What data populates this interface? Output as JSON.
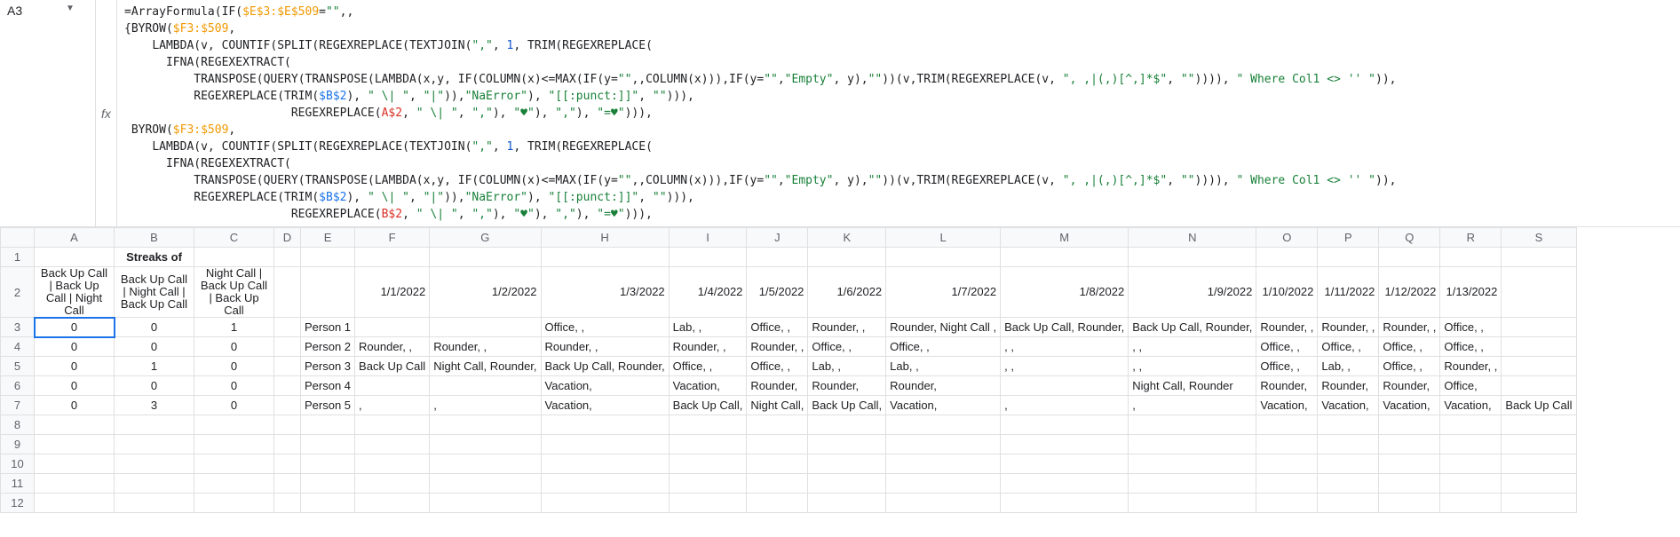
{
  "name_box": "A3",
  "formula_tokens": [
    [
      {
        "t": "=",
        "c": "tok-eq"
      },
      {
        "t": "ArrayFormula",
        "c": "tok-fn"
      },
      {
        "t": "(",
        "c": "tok-punct"
      },
      {
        "t": "IF",
        "c": "tok-fn"
      },
      {
        "t": "(",
        "c": "tok-punct"
      },
      {
        "t": "$E$3:$E$509",
        "c": "tok-ref1"
      },
      {
        "t": "=",
        "c": "tok-punct"
      },
      {
        "t": "\"\"",
        "c": "tok-str"
      },
      {
        "t": ",,",
        "c": "tok-punct"
      }
    ],
    [
      {
        "t": "{",
        "c": "tok-punct"
      },
      {
        "t": "BYROW",
        "c": "tok-fn"
      },
      {
        "t": "(",
        "c": "tok-punct"
      },
      {
        "t": "$F3:$509",
        "c": "tok-ref1"
      },
      {
        "t": ",",
        "c": "tok-punct"
      }
    ],
    [
      {
        "t": "    ",
        "c": ""
      },
      {
        "t": "LAMBDA",
        "c": "tok-fn"
      },
      {
        "t": "(v, ",
        "c": "tok-punct"
      },
      {
        "t": "COUNTIF",
        "c": "tok-fn"
      },
      {
        "t": "(",
        "c": "tok-punct"
      },
      {
        "t": "SPLIT",
        "c": "tok-fn"
      },
      {
        "t": "(",
        "c": "tok-punct"
      },
      {
        "t": "REGEXREPLACE",
        "c": "tok-fn"
      },
      {
        "t": "(",
        "c": "tok-punct"
      },
      {
        "t": "TEXTJOIN",
        "c": "tok-fn"
      },
      {
        "t": "(",
        "c": "tok-punct"
      },
      {
        "t": "\",\"",
        "c": "tok-str"
      },
      {
        "t": ", ",
        "c": "tok-punct"
      },
      {
        "t": "1",
        "c": "tok-num"
      },
      {
        "t": ", ",
        "c": "tok-punct"
      },
      {
        "t": "TRIM",
        "c": "tok-fn"
      },
      {
        "t": "(",
        "c": "tok-punct"
      },
      {
        "t": "REGEXREPLACE",
        "c": "tok-fn"
      },
      {
        "t": "(",
        "c": "tok-punct"
      }
    ],
    [
      {
        "t": "      ",
        "c": ""
      },
      {
        "t": "IFNA",
        "c": "tok-fn"
      },
      {
        "t": "(",
        "c": "tok-punct"
      },
      {
        "t": "REGEXEXTRACT",
        "c": "tok-fn"
      },
      {
        "t": "(",
        "c": "tok-punct"
      }
    ],
    [
      {
        "t": "          ",
        "c": ""
      },
      {
        "t": "TRANSPOSE",
        "c": "tok-fn"
      },
      {
        "t": "(",
        "c": "tok-punct"
      },
      {
        "t": "QUERY",
        "c": "tok-fn"
      },
      {
        "t": "(",
        "c": "tok-punct"
      },
      {
        "t": "TRANSPOSE",
        "c": "tok-fn"
      },
      {
        "t": "(",
        "c": "tok-punct"
      },
      {
        "t": "LAMBDA",
        "c": "tok-fn"
      },
      {
        "t": "(x,y, ",
        "c": "tok-punct"
      },
      {
        "t": "IF",
        "c": "tok-fn"
      },
      {
        "t": "(",
        "c": "tok-punct"
      },
      {
        "t": "COLUMN",
        "c": "tok-fn"
      },
      {
        "t": "(x)<=",
        "c": "tok-punct"
      },
      {
        "t": "MAX",
        "c": "tok-fn"
      },
      {
        "t": "(",
        "c": "tok-punct"
      },
      {
        "t": "IF",
        "c": "tok-fn"
      },
      {
        "t": "(y=",
        "c": "tok-punct"
      },
      {
        "t": "\"\"",
        "c": "tok-str"
      },
      {
        "t": ",,",
        "c": "tok-punct"
      },
      {
        "t": "COLUMN",
        "c": "tok-fn"
      },
      {
        "t": "(x))),",
        "c": "tok-punct"
      },
      {
        "t": "IF",
        "c": "tok-fn"
      },
      {
        "t": "(y=",
        "c": "tok-punct"
      },
      {
        "t": "\"\"",
        "c": "tok-str"
      },
      {
        "t": ",",
        "c": "tok-punct"
      },
      {
        "t": "\"Empty\"",
        "c": "tok-str"
      },
      {
        "t": ", y),",
        "c": "tok-punct"
      },
      {
        "t": "\"\"",
        "c": "tok-str"
      },
      {
        "t": "))(v,",
        "c": "tok-punct"
      },
      {
        "t": "TRIM",
        "c": "tok-fn"
      },
      {
        "t": "(",
        "c": "tok-punct"
      },
      {
        "t": "REGEXREPLACE",
        "c": "tok-fn"
      },
      {
        "t": "(v, ",
        "c": "tok-punct"
      },
      {
        "t": "\", ,|(,)[^,]*$\"",
        "c": "tok-str"
      },
      {
        "t": ", ",
        "c": "tok-punct"
      },
      {
        "t": "\"\"",
        "c": "tok-str"
      },
      {
        "t": ")))), ",
        "c": "tok-punct"
      },
      {
        "t": "\" Where Col1 <> '' \"",
        "c": "tok-str"
      },
      {
        "t": ")),",
        "c": "tok-punct"
      }
    ],
    [
      {
        "t": "          ",
        "c": ""
      },
      {
        "t": "REGEXREPLACE",
        "c": "tok-fn"
      },
      {
        "t": "(",
        "c": "tok-punct"
      },
      {
        "t": "TRIM",
        "c": "tok-fn"
      },
      {
        "t": "(",
        "c": "tok-punct"
      },
      {
        "t": "$B$2",
        "c": "tok-ref2"
      },
      {
        "t": "), ",
        "c": "tok-punct"
      },
      {
        "t": "\" \\| \"",
        "c": "tok-str"
      },
      {
        "t": ", ",
        "c": "tok-punct"
      },
      {
        "t": "\"|\"",
        "c": "tok-str"
      },
      {
        "t": ")),",
        "c": "tok-punct"
      },
      {
        "t": "\"NaError\"",
        "c": "tok-str"
      },
      {
        "t": "), ",
        "c": "tok-punct"
      },
      {
        "t": "\"[[:punct:]]\"",
        "c": "tok-str"
      },
      {
        "t": ", ",
        "c": "tok-punct"
      },
      {
        "t": "\"\"",
        "c": "tok-str"
      },
      {
        "t": "))),",
        "c": "tok-punct"
      }
    ],
    [
      {
        "t": "                        ",
        "c": ""
      },
      {
        "t": "REGEXREPLACE",
        "c": "tok-fn"
      },
      {
        "t": "(",
        "c": "tok-punct"
      },
      {
        "t": "A$2",
        "c": "tok-ref3"
      },
      {
        "t": ", ",
        "c": "tok-punct"
      },
      {
        "t": "\" \\| \"",
        "c": "tok-str"
      },
      {
        "t": ", ",
        "c": "tok-punct"
      },
      {
        "t": "\",\"",
        "c": "tok-str"
      },
      {
        "t": "), ",
        "c": "tok-punct"
      },
      {
        "t": "\"♥\"",
        "c": "tok-str"
      },
      {
        "t": "), ",
        "c": "tok-punct"
      },
      {
        "t": "\",\"",
        "c": "tok-str"
      },
      {
        "t": "), ",
        "c": "tok-punct"
      },
      {
        "t": "\"=♥\"",
        "c": "tok-str"
      },
      {
        "t": "))),",
        "c": "tok-punct"
      }
    ],
    [
      {
        "t": " ",
        "c": ""
      },
      {
        "t": "BYROW",
        "c": "tok-fn"
      },
      {
        "t": "(",
        "c": "tok-punct"
      },
      {
        "t": "$F3:$509",
        "c": "tok-ref1"
      },
      {
        "t": ",",
        "c": "tok-punct"
      }
    ],
    [
      {
        "t": "    ",
        "c": ""
      },
      {
        "t": "LAMBDA",
        "c": "tok-fn"
      },
      {
        "t": "(v, ",
        "c": "tok-punct"
      },
      {
        "t": "COUNTIF",
        "c": "tok-fn"
      },
      {
        "t": "(",
        "c": "tok-punct"
      },
      {
        "t": "SPLIT",
        "c": "tok-fn"
      },
      {
        "t": "(",
        "c": "tok-punct"
      },
      {
        "t": "REGEXREPLACE",
        "c": "tok-fn"
      },
      {
        "t": "(",
        "c": "tok-punct"
      },
      {
        "t": "TEXTJOIN",
        "c": "tok-fn"
      },
      {
        "t": "(",
        "c": "tok-punct"
      },
      {
        "t": "\",\"",
        "c": "tok-str"
      },
      {
        "t": ", ",
        "c": "tok-punct"
      },
      {
        "t": "1",
        "c": "tok-num"
      },
      {
        "t": ", ",
        "c": "tok-punct"
      },
      {
        "t": "TRIM",
        "c": "tok-fn"
      },
      {
        "t": "(",
        "c": "tok-punct"
      },
      {
        "t": "REGEXREPLACE",
        "c": "tok-fn"
      },
      {
        "t": "(",
        "c": "tok-punct"
      }
    ],
    [
      {
        "t": "      ",
        "c": ""
      },
      {
        "t": "IFNA",
        "c": "tok-fn"
      },
      {
        "t": "(",
        "c": "tok-punct"
      },
      {
        "t": "REGEXEXTRACT",
        "c": "tok-fn"
      },
      {
        "t": "(",
        "c": "tok-punct"
      }
    ],
    [
      {
        "t": "          ",
        "c": ""
      },
      {
        "t": "TRANSPOSE",
        "c": "tok-fn"
      },
      {
        "t": "(",
        "c": "tok-punct"
      },
      {
        "t": "QUERY",
        "c": "tok-fn"
      },
      {
        "t": "(",
        "c": "tok-punct"
      },
      {
        "t": "TRANSPOSE",
        "c": "tok-fn"
      },
      {
        "t": "(",
        "c": "tok-punct"
      },
      {
        "t": "LAMBDA",
        "c": "tok-fn"
      },
      {
        "t": "(x,y, ",
        "c": "tok-punct"
      },
      {
        "t": "IF",
        "c": "tok-fn"
      },
      {
        "t": "(",
        "c": "tok-punct"
      },
      {
        "t": "COLUMN",
        "c": "tok-fn"
      },
      {
        "t": "(x)<=",
        "c": "tok-punct"
      },
      {
        "t": "MAX",
        "c": "tok-fn"
      },
      {
        "t": "(",
        "c": "tok-punct"
      },
      {
        "t": "IF",
        "c": "tok-fn"
      },
      {
        "t": "(y=",
        "c": "tok-punct"
      },
      {
        "t": "\"\"",
        "c": "tok-str"
      },
      {
        "t": ",,",
        "c": "tok-punct"
      },
      {
        "t": "COLUMN",
        "c": "tok-fn"
      },
      {
        "t": "(x))),",
        "c": "tok-punct"
      },
      {
        "t": "IF",
        "c": "tok-fn"
      },
      {
        "t": "(y=",
        "c": "tok-punct"
      },
      {
        "t": "\"\"",
        "c": "tok-str"
      },
      {
        "t": ",",
        "c": "tok-punct"
      },
      {
        "t": "\"Empty\"",
        "c": "tok-str"
      },
      {
        "t": ", y),",
        "c": "tok-punct"
      },
      {
        "t": "\"\"",
        "c": "tok-str"
      },
      {
        "t": "))(v,",
        "c": "tok-punct"
      },
      {
        "t": "TRIM",
        "c": "tok-fn"
      },
      {
        "t": "(",
        "c": "tok-punct"
      },
      {
        "t": "REGEXREPLACE",
        "c": "tok-fn"
      },
      {
        "t": "(v, ",
        "c": "tok-punct"
      },
      {
        "t": "\", ,|(,)[^,]*$\"",
        "c": "tok-str"
      },
      {
        "t": ", ",
        "c": "tok-punct"
      },
      {
        "t": "\"\"",
        "c": "tok-str"
      },
      {
        "t": ")))), ",
        "c": "tok-punct"
      },
      {
        "t": "\" Where Col1 <> '' \"",
        "c": "tok-str"
      },
      {
        "t": ")),",
        "c": "tok-punct"
      }
    ],
    [
      {
        "t": "          ",
        "c": ""
      },
      {
        "t": "REGEXREPLACE",
        "c": "tok-fn"
      },
      {
        "t": "(",
        "c": "tok-punct"
      },
      {
        "t": "TRIM",
        "c": "tok-fn"
      },
      {
        "t": "(",
        "c": "tok-punct"
      },
      {
        "t": "$B$2",
        "c": "tok-ref2"
      },
      {
        "t": "), ",
        "c": "tok-punct"
      },
      {
        "t": "\" \\| \"",
        "c": "tok-str"
      },
      {
        "t": ", ",
        "c": "tok-punct"
      },
      {
        "t": "\"|\"",
        "c": "tok-str"
      },
      {
        "t": ")),",
        "c": "tok-punct"
      },
      {
        "t": "\"NaError\"",
        "c": "tok-str"
      },
      {
        "t": "), ",
        "c": "tok-punct"
      },
      {
        "t": "\"[[:punct:]]\"",
        "c": "tok-str"
      },
      {
        "t": ", ",
        "c": "tok-punct"
      },
      {
        "t": "\"\"",
        "c": "tok-str"
      },
      {
        "t": "))),",
        "c": "tok-punct"
      }
    ],
    [
      {
        "t": "                        ",
        "c": ""
      },
      {
        "t": "REGEXREPLACE",
        "c": "tok-fn"
      },
      {
        "t": "(",
        "c": "tok-punct"
      },
      {
        "t": "B$2",
        "c": "tok-ref3"
      },
      {
        "t": ", ",
        "c": "tok-punct"
      },
      {
        "t": "\" \\| \"",
        "c": "tok-str"
      },
      {
        "t": ", ",
        "c": "tok-punct"
      },
      {
        "t": "\",\"",
        "c": "tok-str"
      },
      {
        "t": "), ",
        "c": "tok-punct"
      },
      {
        "t": "\"♥\"",
        "c": "tok-str"
      },
      {
        "t": "), ",
        "c": "tok-punct"
      },
      {
        "t": "\",\"",
        "c": "tok-str"
      },
      {
        "t": "), ",
        "c": "tok-punct"
      },
      {
        "t": "\"=♥\"",
        "c": "tok-str"
      },
      {
        "t": "))),",
        "c": "tok-punct"
      }
    ]
  ],
  "column_letters": [
    "A",
    "B",
    "C",
    "D",
    "E",
    "F",
    "G",
    "H",
    "I",
    "J",
    "K",
    "L",
    "M",
    "N",
    "O",
    "P",
    "Q",
    "R",
    "S"
  ],
  "row_numbers": [
    "1",
    "2",
    "3",
    "4",
    "5",
    "6",
    "7",
    "8",
    "9",
    "10",
    "11",
    "12"
  ],
  "row1": {
    "B": "Streaks of"
  },
  "row2": {
    "A": "Back Up Call | Back Up Call | Night Call",
    "B": "Back Up Call | Night Call | Back Up Call",
    "C": "Night Call | Back Up Call | Back Up Call",
    "F": "1/1/2022",
    "G": "1/2/2022",
    "H": "1/3/2022",
    "I": "1/4/2022",
    "J": "1/5/2022",
    "K": "1/6/2022",
    "L": "1/7/2022",
    "M": "1/8/2022",
    "N": "1/9/2022",
    "O": "1/10/2022",
    "P": "1/11/2022",
    "Q": "1/12/2022",
    "R": "1/13/2022"
  },
  "data_rows": [
    {
      "n": "3",
      "A": "0",
      "B": "0",
      "C": "1",
      "E": "Person 1",
      "H": "Office, ,",
      "I": "Lab, ,",
      "J": "Office, ,",
      "K": "Rounder, ,",
      "L": "Rounder, Night Call ,",
      "M": "Back Up Call, Rounder,",
      "N": "Back Up Call, Rounder,",
      "O": "Rounder, ,",
      "P": "Rounder, ,",
      "Q": "Rounder, ,",
      "R": "Office, ,"
    },
    {
      "n": "4",
      "A": "0",
      "B": "0",
      "C": "0",
      "E": "Person 2",
      "F": "Rounder, ,",
      "G": "Rounder, ,",
      "H": "Rounder, ,",
      "I": "Rounder, ,",
      "J": "Rounder, ,",
      "K": "Office, ,",
      "L": "Office, ,",
      "M": ", ,",
      "N": ", ,",
      "O": "Office, ,",
      "P": "Office, ,",
      "Q": "Office, ,",
      "R": "Office, ,"
    },
    {
      "n": "5",
      "A": "0",
      "B": "1",
      "C": "0",
      "E": "Person 3",
      "F": "Back Up Call",
      "G": "Night Call, Rounder,",
      "H": "Back Up Call, Rounder,",
      "I": "Office, ,",
      "J": "Office, ,",
      "K": "Lab, ,",
      "L": "Lab, ,",
      "M": ", ,",
      "N": ", ,",
      "O": "Office, ,",
      "P": "Lab, ,",
      "Q": "Office, ,",
      "R": "Rounder, ,"
    },
    {
      "n": "6",
      "A": "0",
      "B": "0",
      "C": "0",
      "E": "Person 4",
      "H": "Vacation,",
      "I": "Vacation,",
      "J": "Rounder,",
      "K": "Rounder,",
      "L": "Rounder,",
      "N": "Night Call, Rounder",
      "O": "Rounder,",
      "P": "Rounder,",
      "Q": "Rounder,",
      "R": "Office,"
    },
    {
      "n": "7",
      "A": "0",
      "B": "3",
      "C": "0",
      "E": "Person 5",
      "F": ",",
      "G": ",",
      "H": "Vacation,",
      "I": "Back Up Call,",
      "J": "Night Call,",
      "K": "Back Up Call,",
      "L": "Vacation,",
      "M": ",",
      "N": ",",
      "O": "Vacation,",
      "P": "Vacation,",
      "Q": "Vacation,",
      "R": "Vacation,",
      "S": "Back Up Call"
    }
  ],
  "fx_label": "fx",
  "selected_cell": "A3"
}
